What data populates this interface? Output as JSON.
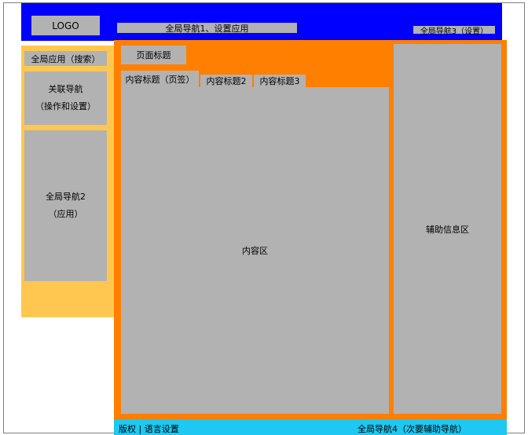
{
  "header": {
    "logo": "LOGO",
    "global_nav_1": "全局导航1、设置应用",
    "global_nav_3": "全局导航3（设置）"
  },
  "sidebar": {
    "global_app_search": "全局应用（搜索）",
    "related_nav": {
      "line1": "关联导航",
      "line2": "（操作和设置）"
    },
    "global_nav_2": {
      "line1": "全局导航2",
      "line2": "（应用）"
    }
  },
  "main": {
    "page_title": "页面标题",
    "tabs": [
      {
        "label": "内容标题（页签）"
      },
      {
        "label": "内容标题2"
      },
      {
        "label": "内容标题3"
      }
    ],
    "content_area": "内容区",
    "aux_info": "辅助信息区"
  },
  "footer": {
    "left": "版权 | 语言设置",
    "right": "全局导航4（次要辅助导航）"
  },
  "colors": {
    "header": "#0000ff",
    "sidebar": "#ffc74f",
    "main_frame": "#ff7f00",
    "footer": "#1ec8f0",
    "block": "#b2b2b2"
  }
}
